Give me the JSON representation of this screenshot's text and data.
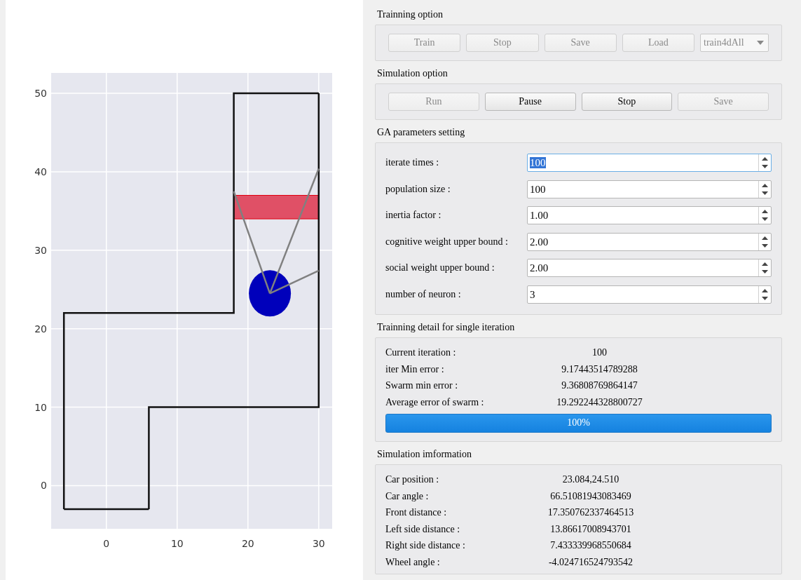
{
  "plot": {
    "chart_data": {
      "type": "line",
      "xlim": [
        -7.8,
        31.9
      ],
      "ylim": [
        -5.5,
        52.6
      ],
      "xticks": [
        0,
        10,
        20,
        30
      ],
      "yticks": [
        0,
        10,
        20,
        30,
        40,
        50
      ],
      "series": [
        {
          "type": "area",
          "color": "#e05066",
          "x": [
            18,
            30,
            30,
            18,
            18
          ],
          "values": [
            34,
            34,
            37,
            37,
            34
          ]
        },
        {
          "color": "#111111",
          "x": [
            -6,
            -6,
            18,
            18,
            30
          ],
          "values": [
            -3,
            22,
            22,
            50,
            50
          ]
        },
        {
          "color": "#111111",
          "x": [
            6,
            6,
            30,
            30
          ],
          "values": [
            -3,
            10,
            10,
            50
          ]
        },
        {
          "color": "#111111",
          "x": [
            -6,
            6
          ],
          "values": [
            -3,
            -3
          ]
        },
        {
          "type": "scatter",
          "color": "#0000bb",
          "x": [
            23.1
          ],
          "values": [
            24.5
          ]
        },
        {
          "color": "#808080",
          "x": [
            18,
            23.1
          ],
          "values": [
            37.5,
            24.5
          ]
        },
        {
          "color": "#808080",
          "x": [
            23.1,
            30
          ],
          "values": [
            24.5,
            40.4
          ]
        },
        {
          "color": "#808080",
          "x": [
            23.1,
            30
          ],
          "values": [
            24.5,
            27.4
          ]
        }
      ],
      "grid": true
    }
  },
  "training_option": {
    "title": "Trainning option",
    "buttons": [
      {
        "label": "Train",
        "disabled": true
      },
      {
        "label": "Stop",
        "disabled": true
      },
      {
        "label": "Save",
        "disabled": true
      },
      {
        "label": "Load",
        "disabled": true
      }
    ],
    "dropdown": {
      "value": "train4dAll",
      "disabled": true
    }
  },
  "simulation_option": {
    "title": "Simulation option",
    "buttons": [
      {
        "label": "Run",
        "disabled": true
      },
      {
        "label": "Pause",
        "disabled": false
      },
      {
        "label": "Stop",
        "disabled": false
      },
      {
        "label": "Save",
        "disabled": true
      }
    ]
  },
  "ga_parameters": {
    "title": "GA parameters setting",
    "fields": [
      {
        "label": "iterate times :",
        "value": "100",
        "focused": true
      },
      {
        "label": "population size :",
        "value": "100",
        "focused": false
      },
      {
        "label": "inertia factor :",
        "value": "1.00",
        "focused": false
      },
      {
        "label": "cognitive weight upper bound :",
        "value": "2.00",
        "focused": false
      },
      {
        "label": "social weight upper bound :",
        "value": "2.00",
        "focused": false
      },
      {
        "label": "number of neuron :",
        "value": "3",
        "focused": false
      }
    ]
  },
  "training_detail": {
    "title": "Trainning detail for single iteration",
    "rows": [
      {
        "label": "Current iteration :",
        "value": "100"
      },
      {
        "label": "iter Min error :",
        "value": "9.17443514789288"
      },
      {
        "label": "Swarm min error :",
        "value": "9.36808769864147"
      },
      {
        "label": "Average error of swarm :",
        "value": "19.292244328800727"
      }
    ],
    "progress": {
      "level": 1,
      "text": "100%"
    }
  },
  "simulation_info": {
    "title": "Simulation imformation",
    "rows": [
      {
        "label": "Car position :",
        "value": "23.084,24.510"
      },
      {
        "label": "Car angle :",
        "value": "66.51081943083469"
      },
      {
        "label": "Front distance :",
        "value": "17.350762337464513"
      },
      {
        "label": "Left side distance :",
        "value": "13.86617008943701"
      },
      {
        "label": "Right side distance :",
        "value": "7.433339968550684"
      },
      {
        "label": "Wheel angle :",
        "value": "-4.024716524793542"
      }
    ]
  }
}
